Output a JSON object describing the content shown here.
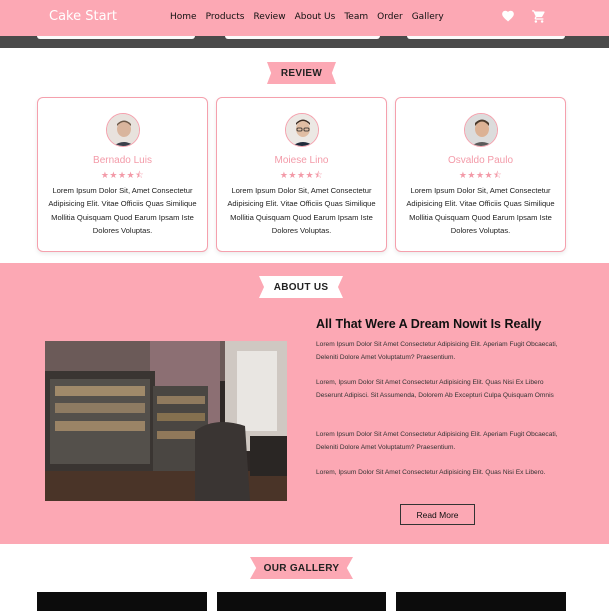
{
  "navbar": {
    "brand": "Cake Start",
    "links": [
      "Home",
      "Products",
      "Review",
      "About Us",
      "Team",
      "Order",
      "Gallery"
    ],
    "icons": [
      "heart-icon",
      "cart-icon"
    ]
  },
  "review": {
    "title": "REVIEW",
    "cards": [
      {
        "name": "Bernado Luis",
        "rating": 4.5,
        "stars": "★★★★⯪",
        "text": "Lorem Ipsum Dolor Sit, Amet Consectetur Adipisicing Elit. Vitae Officiis Quas Similique Mollitia Quisquam Quod Earum Ipsam Iste Dolores Voluptas."
      },
      {
        "name": "Moiese Lino",
        "rating": 4.5,
        "stars": "★★★★⯪",
        "text": "Lorem Ipsum Dolor Sit, Amet Consectetur Adipisicing Elit. Vitae Officiis Quas Similique Mollitia Quisquam Quod Earum Ipsam Iste Dolores Voluptas."
      },
      {
        "name": "Osvaldo Paulo",
        "rating": 4.5,
        "stars": "★★★★⯪",
        "text": "Lorem Ipsum Dolor Sit, Amet Consectetur Adipisicing Elit. Vitae Officiis Quas Similique Mollitia Quisquam Quod Earum Ipsam Iste Dolores Voluptas."
      }
    ]
  },
  "about": {
    "title": "ABOUT US",
    "heading": "All That Were A Dream Nowit Is Really",
    "paragraphs": [
      "Lorem Ipsum Dolor Sit Amet Consectetur Adipisicing Elit. Aperiam Fugit Obcaecati, Deleniti Dolore Amet Voluptatum? Praesentium.",
      "Lorem, Ipsum Dolor Sit Amet Consectetur Adipisicing Elit. Quas Nisi Ex Libero Deserunt Adipisci. Sit Assumenda, Dolorem Ab Excepturi Culpa Quisquam Omnis",
      "Lorem Ipsum Dolor Sit Amet Consectetur Adipisicing Elit. Aperiam Fugit Obcaecati, Deleniti Dolore Amet Voluptatum? Praesentium.",
      "Lorem, Ipsum Dolor Sit Amet Consectetur Adipisicing Elit. Quas Nisi Ex Libero."
    ],
    "button": "Read More"
  },
  "gallery": {
    "title": "OUR GALLERY"
  },
  "colors": {
    "accent": "#fca8b4",
    "accent_text": "#f39aa8",
    "dark_band": "#4a4a4a"
  }
}
